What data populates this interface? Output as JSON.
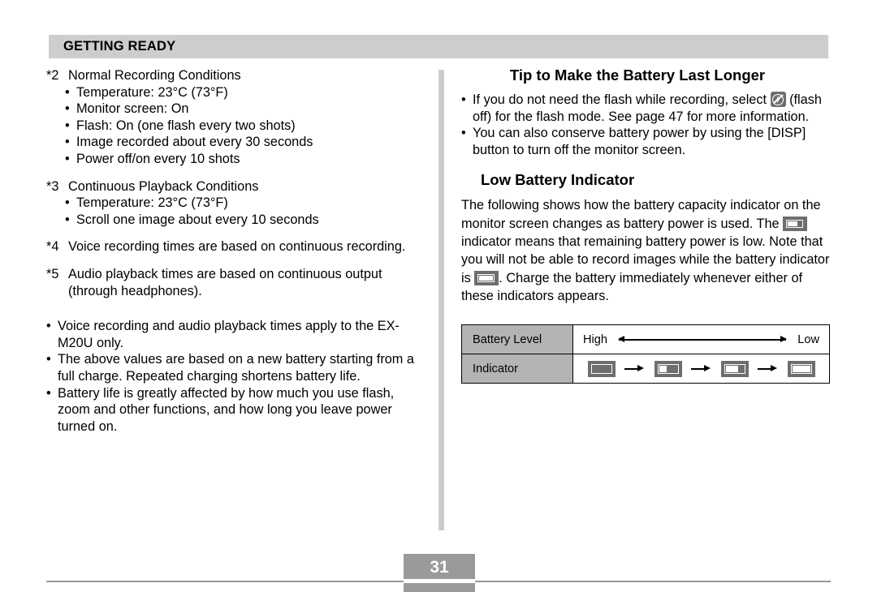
{
  "header": {
    "title": "GETTING READY"
  },
  "left_column": {
    "notes": [
      {
        "marker": "*2",
        "title": "Normal Recording Conditions",
        "items": [
          "Temperature: 23°C (73°F)",
          "Monitor screen: On",
          "Flash: On (one flash every two shots)",
          "Image recorded about every 30 seconds",
          "Power off/on every 10 shots"
        ]
      },
      {
        "marker": "*3",
        "title": "Continuous Playback Conditions",
        "items": [
          "Temperature: 23°C (73°F)",
          "Scroll one image about every 10 seconds"
        ]
      },
      {
        "marker": "*4",
        "title": "Voice recording times are based on continuous recording.",
        "items": []
      },
      {
        "marker": "*5",
        "title": "Audio playback times are based on continuous output (through headphones).",
        "items": []
      }
    ],
    "bullets": [
      "Voice recording and audio playback times apply to the EX-M20U only.",
      "The above values are based on a new battery starting from a full charge. Repeated charging shortens battery life.",
      "Battery life is greatly affected by how much you use flash, zoom and other functions, and how long you leave power turned on."
    ]
  },
  "right_column": {
    "tip_heading": "Tip to Make the Battery Last Longer",
    "tip_bullets": [
      {
        "text_before": "If you do not need the flash while recording, select ",
        "icon": "flash-off-icon",
        "text_after": " (flash off) for the flash mode. See page 47 for more information."
      },
      {
        "text_before": "You can also conserve battery power by using the [DISP] button to turn off the monitor screen.",
        "icon": null,
        "text_after": ""
      }
    ],
    "low_battery_heading": "Low Battery Indicator",
    "low_battery_paragraph": {
      "part1": "The following shows how the battery capacity indicator on the monitor screen changes as battery power is used. The ",
      "icon1": "battery-two-thirds-icon",
      "part2": " indicator means that remaining battery power is low. Note that you will not be able to record images while the battery indicator is ",
      "icon2": "battery-empty-icon",
      "part3": ". Charge the battery immediately whenever either of these indicators appears."
    },
    "table": {
      "rows": [
        {
          "label": "Battery Level",
          "type": "range",
          "left_value": "High",
          "right_value": "Low"
        },
        {
          "label": "Indicator",
          "type": "icons",
          "icons": [
            "battery-full-icon",
            "battery-two-thirds-icon",
            "battery-one-third-icon",
            "battery-empty-icon"
          ]
        }
      ]
    }
  },
  "footer": {
    "page_number": "31"
  },
  "colors": {
    "header_bar": "#cdcdcd",
    "divider": "#cccccc",
    "table_label_cell": "#b4b4b4",
    "icon_background": "#6e6e6e",
    "footer_gray": "#9a9a9a"
  }
}
